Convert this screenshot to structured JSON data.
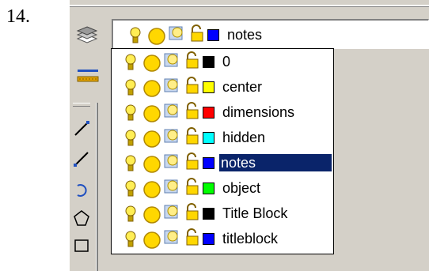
{
  "step_number": "14.",
  "combo": {
    "current_layer": {
      "name": "notes",
      "color": "#0000ff"
    }
  },
  "layers": [
    {
      "name": "0",
      "color": "#000000"
    },
    {
      "name": "center",
      "color": "#ffff00"
    },
    {
      "name": "dimensions",
      "color": "#ff0000"
    },
    {
      "name": "hidden",
      "color": "#00ffff"
    },
    {
      "name": "notes",
      "color": "#0000ff",
      "selected": true
    },
    {
      "name": "object",
      "color": "#00ff00"
    },
    {
      "name": "Title Block",
      "color": "#000000"
    },
    {
      "name": "titleblock",
      "color": "#0000ff"
    }
  ],
  "icons": {
    "on_off": "lightbulb-icon",
    "thaw_freeze": "sun-icon",
    "viewport_freeze": "freeze-viewport-icon",
    "lock": "padlock-icon",
    "layers_toolbar": "layers-icon",
    "layer_properties": "layer-properties-icon"
  },
  "colors": {
    "selection": "#0a246a",
    "toolbar_bg": "#d4d0c8"
  }
}
